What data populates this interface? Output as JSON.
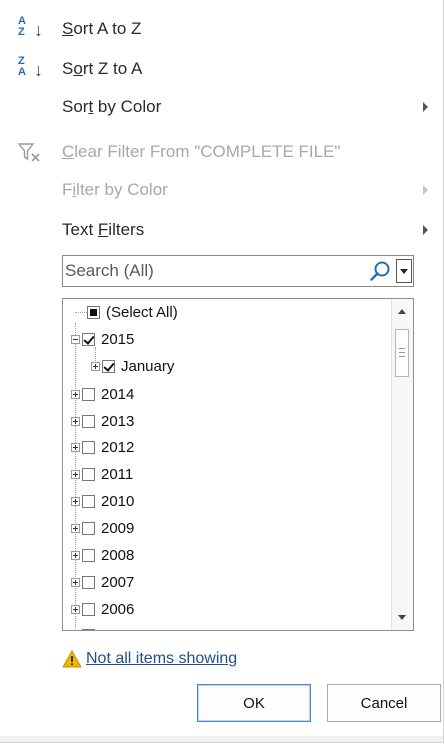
{
  "menu": {
    "sort_az": {
      "label": "Sort A to Z",
      "icon": "sort-az-icon",
      "icon_letters": [
        "A",
        "Z"
      ]
    },
    "sort_za": {
      "label": "Sort Z to A",
      "icon": "sort-za-icon",
      "icon_letters": [
        "Z",
        "A"
      ]
    },
    "sort_color": {
      "label": "Sort by Color",
      "has_submenu": true
    },
    "clear_filter": {
      "label": "Clear Filter From \"COMPLETE FILE\"",
      "icon": "clear-filter-icon",
      "disabled": true
    },
    "filter_color": {
      "label": "Filter by Color",
      "has_submenu": true,
      "disabled": true
    },
    "text_filters": {
      "label": "Text Filters",
      "has_submenu": true
    }
  },
  "search": {
    "placeholder": "Search (All)",
    "value": ""
  },
  "tree": {
    "items": [
      {
        "label": "(Select All)",
        "state": "partial",
        "level": 0,
        "expander": "none"
      },
      {
        "label": "2015",
        "state": "checked",
        "level": 0,
        "expander": "minus"
      },
      {
        "label": "January",
        "state": "checked",
        "level": 1,
        "expander": "plus"
      },
      {
        "label": "2014",
        "state": "unchecked",
        "level": 0,
        "expander": "plus"
      },
      {
        "label": "2013",
        "state": "unchecked",
        "level": 0,
        "expander": "plus"
      },
      {
        "label": "2012",
        "state": "unchecked",
        "level": 0,
        "expander": "plus"
      },
      {
        "label": "2011",
        "state": "unchecked",
        "level": 0,
        "expander": "plus"
      },
      {
        "label": "2010",
        "state": "unchecked",
        "level": 0,
        "expander": "plus"
      },
      {
        "label": "2009",
        "state": "unchecked",
        "level": 0,
        "expander": "plus"
      },
      {
        "label": "2008",
        "state": "unchecked",
        "level": 0,
        "expander": "plus"
      },
      {
        "label": "2007",
        "state": "unchecked",
        "level": 0,
        "expander": "plus"
      },
      {
        "label": "2006",
        "state": "unchecked",
        "level": 0,
        "expander": "plus"
      }
    ]
  },
  "warning": {
    "text": "Not all items showing",
    "icon": "warning-icon"
  },
  "buttons": {
    "ok": "OK",
    "cancel": "Cancel"
  },
  "colors": {
    "accent": "#4a87cc",
    "link": "#1f4e8c",
    "disabled_text": "#a8a8a8",
    "warning": "#e8a400"
  }
}
